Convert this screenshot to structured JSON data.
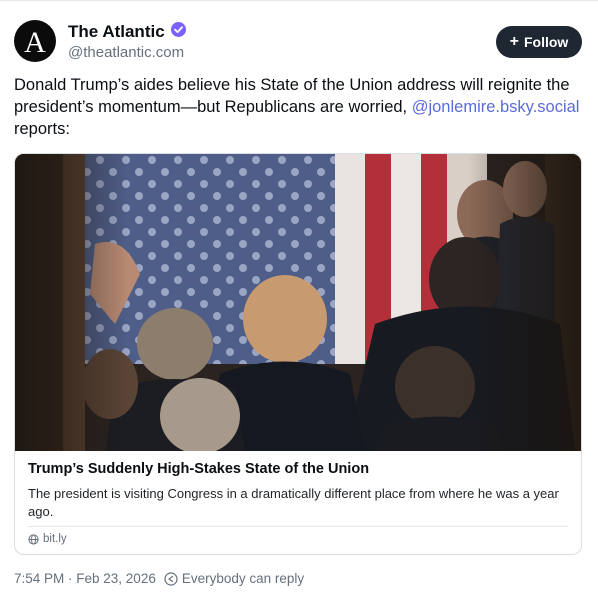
{
  "post": {
    "author": {
      "display_name": "The Atlantic",
      "handle": "@theatlantic.com",
      "verified": true,
      "avatar_letter": "A"
    },
    "follow_button": {
      "label": "Follow",
      "icon": "plus-icon"
    },
    "text_parts": [
      "Donald Trump’s aides believe his State of the Union address will reignite the president’s momentum—but Republicans are worried, ",
      "@jonlemire.bsky.social",
      " reports:"
    ],
    "link_card": {
      "image": "photo-of-trump-entering-house-chamber-with-flag",
      "title": "Trump’s Suddenly High-Stakes State of the Union",
      "description": "The president is visiting Congress in a dramatically different place from where he was a year ago.",
      "domain": "bit.ly",
      "domain_icon": "globe-icon"
    },
    "timestamp": "7:54 PM · Feb 23, 2026",
    "reply_setting": "Everybody can reply",
    "reply_icon": "reply-circle-icon"
  },
  "colors": {
    "accent": "#5b6bd8",
    "verified_badge": "#7b61ff",
    "follow_button_bg": "#1e2732",
    "muted_text": "#66717d"
  }
}
